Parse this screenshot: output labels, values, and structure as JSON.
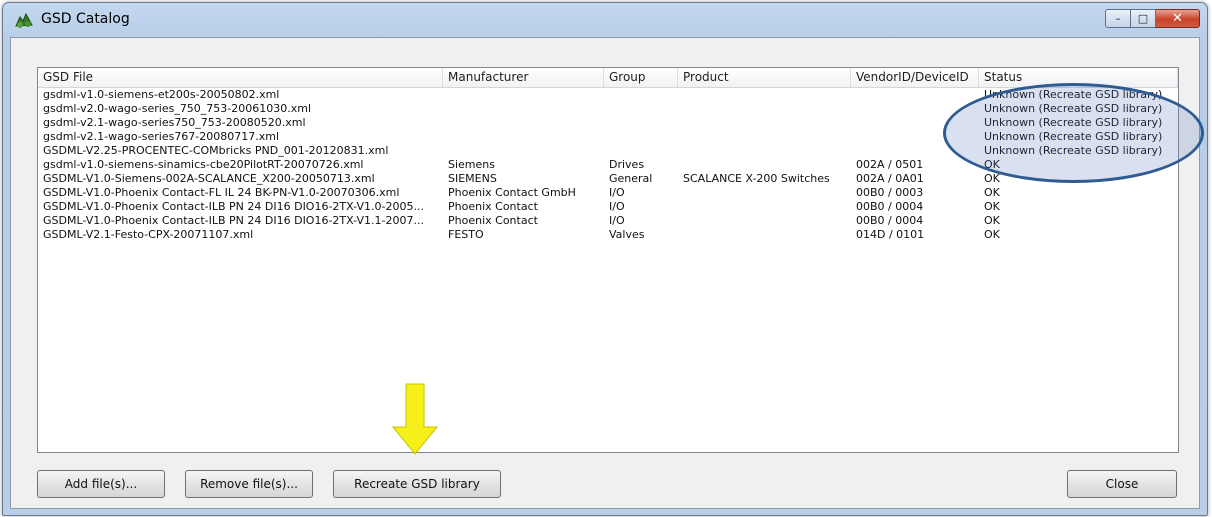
{
  "window": {
    "title": "GSD Catalog",
    "caption_buttons": {
      "minimize": "–",
      "maximize": "□",
      "close": "✕"
    }
  },
  "table": {
    "columns": [
      "GSD File",
      "Manufacturer",
      "Group",
      "Product",
      "VendorID/DeviceID",
      "Status"
    ],
    "rows": [
      [
        "gsdml-v1.0-siemens-et200s-20050802.xml",
        "",
        "",
        "",
        "",
        "Unknown (Recreate GSD library)"
      ],
      [
        "gsdml-v2.0-wago-series_750_753-20061030.xml",
        "",
        "",
        "",
        "",
        "Unknown (Recreate GSD library)"
      ],
      [
        "gsdml-v2.1-wago-series750_753-20080520.xml",
        "",
        "",
        "",
        "",
        "Unknown (Recreate GSD library)"
      ],
      [
        "gsdml-v2.1-wago-series767-20080717.xml",
        "",
        "",
        "",
        "",
        "Unknown (Recreate GSD library)"
      ],
      [
        "GSDML-V2.25-PROCENTEC-COMbricks PND_001-20120831.xml",
        "",
        "",
        "",
        "",
        "Unknown (Recreate GSD library)"
      ],
      [
        "gsdml-v1.0-siemens-sinamics-cbe20PilotRT-20070726.xml",
        "Siemens",
        "Drives",
        "",
        "002A / 0501",
        "OK"
      ],
      [
        "GSDML-V1.0-Siemens-002A-SCALANCE_X200-20050713.xml",
        "SIEMENS",
        "General",
        "SCALANCE X-200 Switches",
        "002A / 0A01",
        "OK"
      ],
      [
        "GSDML-V1.0-Phoenix Contact-FL IL 24 BK-PN-V1.0-20070306.xml",
        "Phoenix Contact GmbH",
        "I/O",
        "",
        "00B0 / 0003",
        "OK"
      ],
      [
        "GSDML-V1.0-Phoenix Contact-ILB PN 24 DI16 DIO16-2TX-V1.0-2005...",
        "Phoenix Contact",
        "I/O",
        "",
        "00B0 / 0004",
        "OK"
      ],
      [
        "GSDML-V1.0-Phoenix Contact-ILB PN 24 DI16 DIO16-2TX-V1.1-2007...",
        "Phoenix Contact",
        "I/O",
        "",
        "00B0 / 0004",
        "OK"
      ],
      [
        "GSDML-V2.1-Festo-CPX-20071107.xml",
        "FESTO",
        "Valves",
        "",
        "014D / 0101",
        "OK"
      ]
    ]
  },
  "buttons": {
    "add": "Add file(s)...",
    "remove": "Remove file(s)...",
    "recreate": "Recreate GSD library",
    "close": "Close"
  },
  "annotations": {
    "ellipse_color": "#2f5b92",
    "arrow_color": "#f5f019"
  }
}
